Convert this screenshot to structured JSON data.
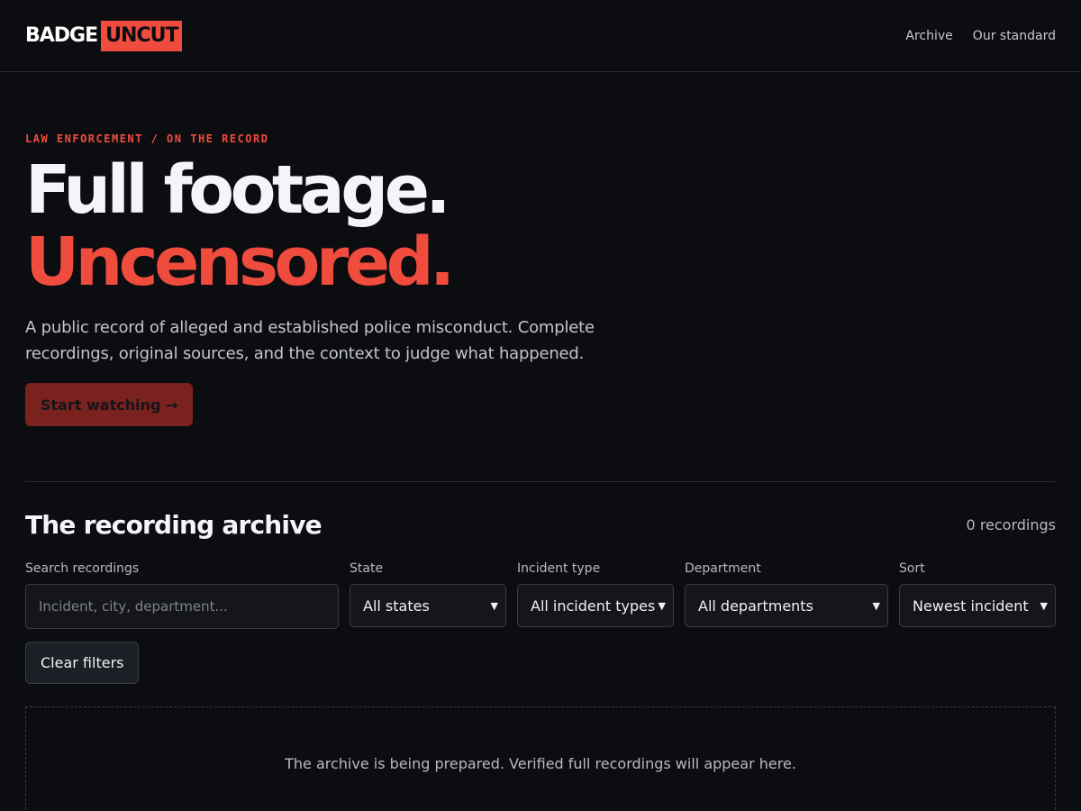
{
  "brand": {
    "part1": "BADGE",
    "part2": "UNCUT"
  },
  "nav": {
    "archive": "Archive",
    "standard": "Our standard"
  },
  "hero": {
    "eyebrow": "LAW ENFORCEMENT / ON THE RECORD",
    "title_line1": "Full footage.",
    "title_line2": "Uncensored.",
    "lead": "A public record of alleged and established police misconduct. Complete recordings, original sources, and the context to judge what happened.",
    "cta": "Start watching →"
  },
  "archive": {
    "title": "The recording archive",
    "count": "0 recordings",
    "filters": {
      "search_label": "Search recordings",
      "search_placeholder": "Incident, city, department...",
      "state_label": "State",
      "state_value": "All states",
      "type_label": "Incident type",
      "type_value": "All incident types",
      "dept_label": "Department",
      "dept_value": "All departments",
      "sort_label": "Sort",
      "sort_value": "Newest incident"
    },
    "clear_label": "Clear filters",
    "empty_message": "The archive is being prepared. Verified full recordings will appear here."
  },
  "colors": {
    "accent": "#f04c3e",
    "background": "#0c0d11"
  }
}
